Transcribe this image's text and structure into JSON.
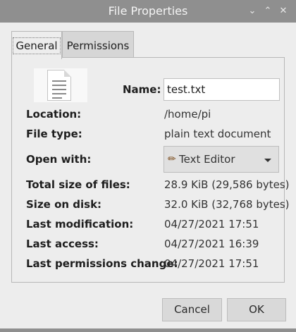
{
  "window": {
    "title": "File Properties",
    "controls": [
      "chevron-down-icon",
      "chevron-up-icon",
      "close-icon"
    ]
  },
  "tabs": [
    {
      "label": "General",
      "active": true
    },
    {
      "label": "Permissions",
      "active": false
    }
  ],
  "general": {
    "icon": "text-document-icon",
    "name_label": "Name:",
    "name_value": "test.txt",
    "location_label": "Location:",
    "location_value": "/home/pi",
    "filetype_label": "File type:",
    "filetype_value": "plain text document",
    "openwith_label": "Open with:",
    "openwith_value": "Text Editor",
    "openwith_icon": "pencil-icon",
    "totalsize_label": "Total size of files:",
    "totalsize_value": "28.9 KiB (29,586 bytes)",
    "disksize_label": "Size on disk:",
    "disksize_value": "32.0 KiB (32,768 bytes)",
    "lastmod_label": "Last modification:",
    "lastmod_value": "04/27/2021 17:51",
    "lastaccess_label": "Last access:",
    "lastaccess_value": "04/27/2021 16:39",
    "lastperm_label": "Last permissions change:",
    "lastperm_value": "04/27/2021 17:51"
  },
  "buttons": {
    "cancel": "Cancel",
    "ok": "OK"
  },
  "colors": {
    "titlebar": "#8f8f8f",
    "window_bg": "#ededed"
  }
}
